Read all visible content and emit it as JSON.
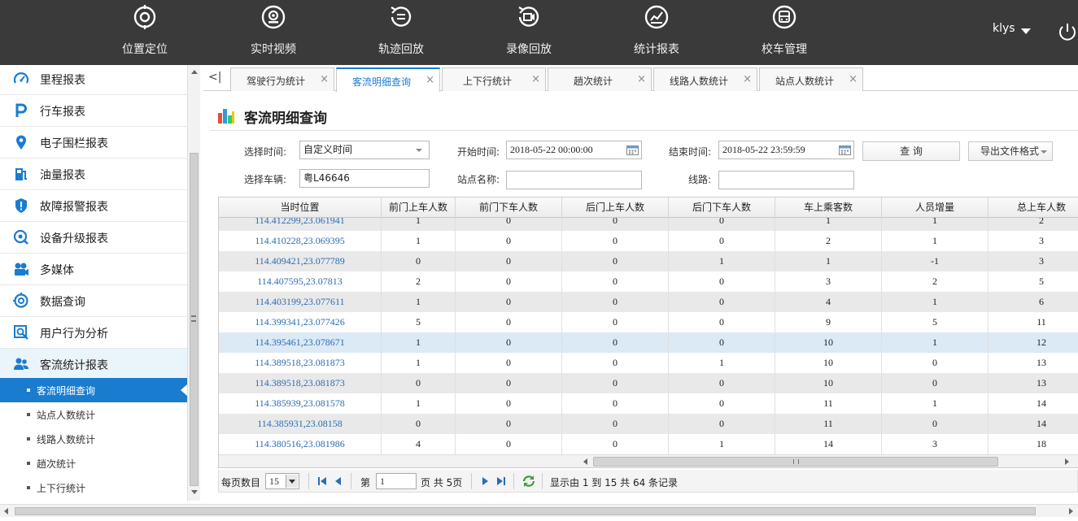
{
  "topnav": {
    "items": [
      {
        "label": "位置定位",
        "icon": "location-target-icon"
      },
      {
        "label": "实时视频",
        "icon": "camera-icon"
      },
      {
        "label": "轨迹回放",
        "icon": "route-replay-icon"
      },
      {
        "label": "录像回放",
        "icon": "video-replay-icon"
      },
      {
        "label": "统计报表",
        "icon": "statistics-chart-icon"
      },
      {
        "label": "校车管理",
        "icon": "school-bus-icon"
      }
    ],
    "username": "klys"
  },
  "sidebar": {
    "items": [
      {
        "label": "里程报表",
        "icon": "speedometer-icon"
      },
      {
        "label": "行车报表",
        "icon": "parking-p-icon"
      },
      {
        "label": "电子围栏报表",
        "icon": "map-pin-icon"
      },
      {
        "label": "油量报表",
        "icon": "fuel-pump-icon"
      },
      {
        "label": "故障报警报表",
        "icon": "alarm-shield-icon"
      },
      {
        "label": "设备升级报表",
        "icon": "upgrade-icon"
      },
      {
        "label": "多媒体",
        "icon": "multimedia-camera-icon"
      },
      {
        "label": "数据查询",
        "icon": "data-query-icon"
      },
      {
        "label": "用户行为分析",
        "icon": "magnifier-icon"
      },
      {
        "label": "客流统计报表",
        "icon": "users-icon"
      }
    ],
    "subitems": [
      {
        "label": "客流明细查询",
        "active": true
      },
      {
        "label": "站点人数统计",
        "active": false
      },
      {
        "label": "线路人数统计",
        "active": false
      },
      {
        "label": "趟次统计",
        "active": false
      },
      {
        "label": "上下行统计",
        "active": false
      }
    ]
  },
  "tabs": [
    {
      "label": "驾驶行为统计",
      "active": false
    },
    {
      "label": "客流明细查询",
      "active": true
    },
    {
      "label": "上下行统计",
      "active": false
    },
    {
      "label": "趟次统计",
      "active": false
    },
    {
      "label": "线路人数统计",
      "active": false
    },
    {
      "label": "站点人数统计",
      "active": false
    }
  ],
  "tab_prev_label": "<|",
  "tab_close_glyph": "×",
  "page": {
    "title": "客流明细查询"
  },
  "filters": {
    "time_select_label": "选择时间:",
    "time_select_value": "自定义时间",
    "start_label": "开始时间:",
    "start_value": "2018-05-22 00:00:00",
    "end_label": "结束时间:",
    "end_value": "2018-05-22 23:59:59",
    "query_button": "查 询",
    "export_button": "导出文件格式",
    "vehicle_label": "选择车辆:",
    "vehicle_value": "粤L46646",
    "station_label": "站点名称:",
    "station_value": "",
    "route_label": "线路:",
    "route_value": ""
  },
  "table": {
    "columns": [
      "当时位置",
      "前门上车人数",
      "前门下车人数",
      "后门上车人数",
      "后门下车人数",
      "车上乘客数",
      "人员增量",
      "总上车人数"
    ],
    "rows": [
      [
        "114.412299,23.061941",
        "1",
        "0",
        "0",
        "0",
        "1",
        "1",
        "2"
      ],
      [
        "114.410228,23.069395",
        "1",
        "0",
        "0",
        "0",
        "2",
        "1",
        "3"
      ],
      [
        "114.409421,23.077789",
        "0",
        "0",
        "0",
        "1",
        "1",
        "-1",
        "3"
      ],
      [
        "114.407595,23.07813",
        "2",
        "0",
        "0",
        "0",
        "3",
        "2",
        "5"
      ],
      [
        "114.403199,23.077611",
        "1",
        "0",
        "0",
        "0",
        "4",
        "1",
        "6"
      ],
      [
        "114.399341,23.077426",
        "5",
        "0",
        "0",
        "0",
        "9",
        "5",
        "11"
      ],
      [
        "114.395461,23.078671",
        "1",
        "0",
        "0",
        "0",
        "10",
        "1",
        "12"
      ],
      [
        "114.389518,23.081873",
        "1",
        "0",
        "0",
        "1",
        "10",
        "0",
        "13"
      ],
      [
        "114.389518,23.081873",
        "0",
        "0",
        "0",
        "0",
        "10",
        "0",
        "13"
      ],
      [
        "114.385939,23.081578",
        "1",
        "0",
        "0",
        "0",
        "11",
        "1",
        "14"
      ],
      [
        "114.385931,23.08158",
        "0",
        "0",
        "0",
        "0",
        "11",
        "0",
        "14"
      ],
      [
        "114.380516,23.081986",
        "4",
        "0",
        "0",
        "1",
        "14",
        "3",
        "18"
      ]
    ],
    "selected_row": 6
  },
  "pager": {
    "per_page_label": "每页数目",
    "per_page_value": "15",
    "page_label_before": "第",
    "page_value": "1",
    "page_label_after": "页 共 5页",
    "summary": "显示由 1 到 15 共 64 条记录"
  },
  "colors": {
    "accent": "#1a7ccf",
    "topbar": "#3a3a3a",
    "link": "#2b6db3"
  }
}
